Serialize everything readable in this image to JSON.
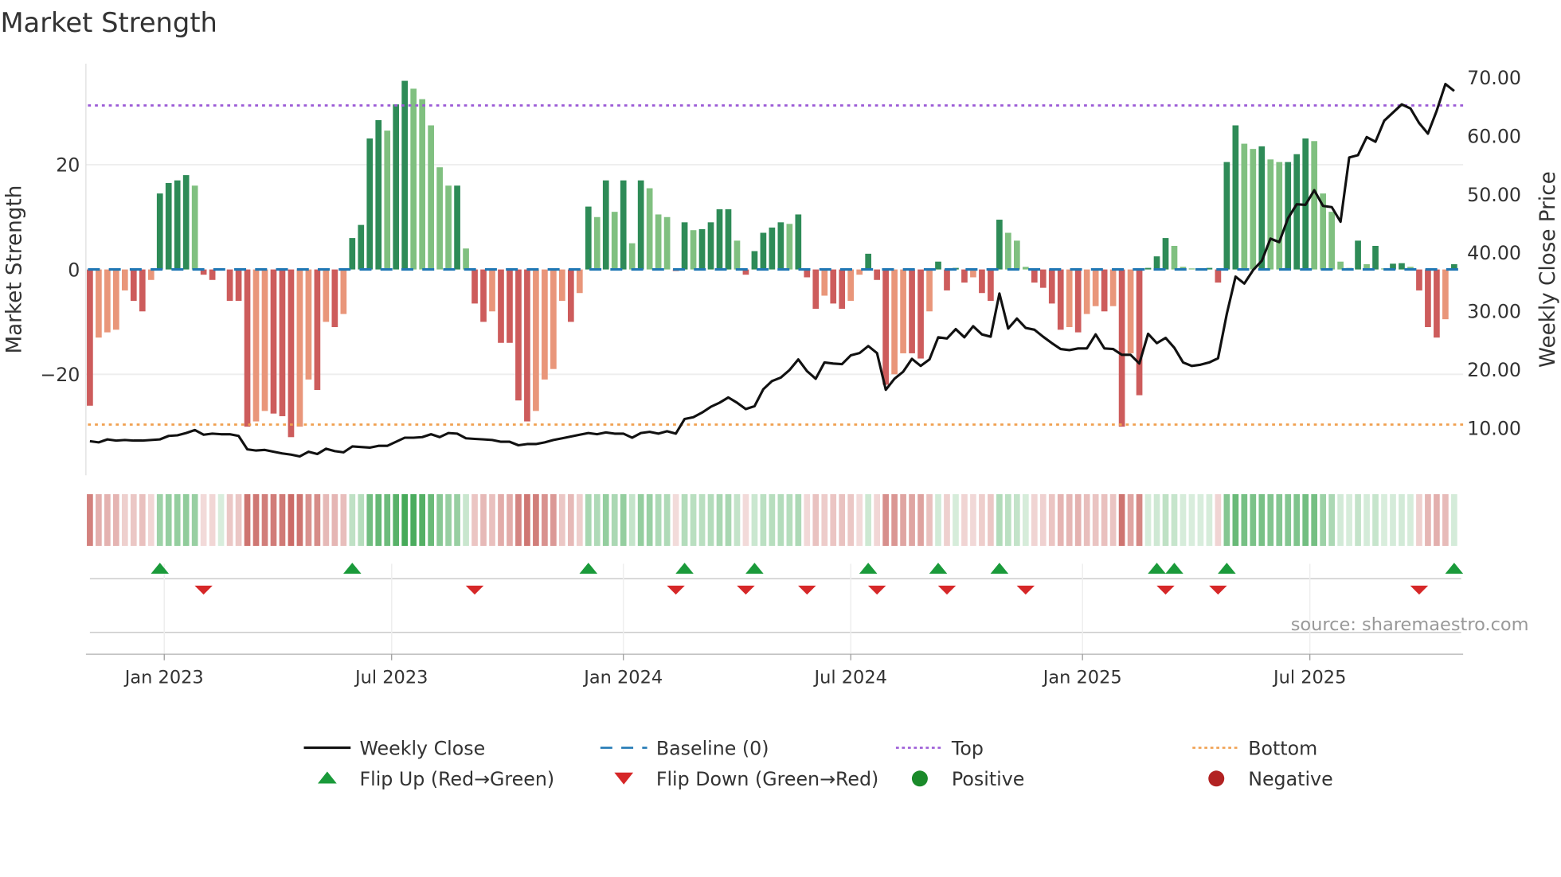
{
  "chart_data": {
    "type": "bar",
    "title": "Market Strength",
    "ylabel": "Market Strength",
    "ylabel_right": "Weekly Close Price",
    "ylim": [
      -39,
      39
    ],
    "ylim_right": [
      3.5,
      72
    ],
    "yticks": [
      {
        "v": 20,
        "label": "20"
      },
      {
        "v": 0,
        "label": "0"
      },
      {
        "v": -20,
        "label": "−20"
      }
    ],
    "yticks_right": [
      "70.00",
      "60.00",
      "50.00",
      "40.00",
      "30.00",
      "20.00",
      "10.00"
    ],
    "yticks_right_values": [
      70,
      60,
      50,
      40,
      30,
      20,
      10
    ],
    "xticks": [
      {
        "week": 8.5,
        "label": "Jan 2023"
      },
      {
        "week": 34.5,
        "label": "Jul 2023"
      },
      {
        "week": 61,
        "label": "Jan 2024"
      },
      {
        "week": 87,
        "label": "Jul 2024"
      },
      {
        "week": 113.5,
        "label": "Jan 2025"
      },
      {
        "week": 139.5,
        "label": "Jul 2025"
      }
    ],
    "top_level": 31.3,
    "bottom_level": -29.6,
    "baseline": 0,
    "strength": [
      -26,
      -13,
      -12,
      -11.5,
      -4,
      -6,
      -8,
      -2,
      14.5,
      16.5,
      17,
      18,
      16,
      -1,
      -2,
      0,
      -6,
      -6,
      -30,
      -29,
      -27,
      -27.5,
      -28,
      -32,
      -30,
      -21,
      -23,
      -10,
      -11,
      -8.5,
      6,
      8.5,
      25,
      28.5,
      26.5,
      31.5,
      36,
      34.5,
      32.5,
      27.5,
      19.5,
      16,
      16,
      4,
      -6.5,
      -10,
      -8,
      -14,
      -14,
      -25,
      -29,
      -27,
      -21,
      -19,
      -6,
      -10,
      -4.5,
      12,
      10,
      17,
      11,
      17,
      5,
      17,
      15.5,
      10.5,
      10,
      -0.3,
      9,
      7.5,
      7.7,
      9,
      11.5,
      11.5,
      5.5,
      -1,
      3.5,
      7,
      8,
      9,
      8.7,
      10.5,
      -1.5,
      -7.5,
      -5,
      -6.5,
      -7.5,
      -6,
      -1,
      3,
      -2,
      -22,
      -20,
      -16,
      -16,
      -17,
      -8,
      1.5,
      -4,
      0.3,
      -2.5,
      -1.5,
      -4.5,
      -6,
      9.5,
      7,
      5.5,
      0.5,
      -2.5,
      -3.5,
      -6.5,
      -11.5,
      -11,
      -12,
      -8.5,
      -7,
      -8,
      -7,
      -30,
      -16,
      -24,
      0.3,
      2.5,
      6,
      4.5,
      0.5,
      0.2,
      0.2,
      0.3,
      -2.5,
      20.5,
      27.5,
      24,
      23,
      23.5,
      21,
      20.5,
      20.5,
      22,
      25,
      24.5,
      14.5,
      11,
      1.5,
      0.3,
      5.5,
      1,
      4.5,
      0.2,
      1.1,
      1.2,
      0.5,
      -4,
      -11,
      -13,
      -9.5,
      1
    ],
    "close": [
      7.7,
      7.5,
      8.0,
      7.8,
      7.9,
      7.8,
      7.8,
      7.9,
      8.0,
      8.6,
      8.7,
      9.1,
      9.6,
      8.8,
      9.0,
      8.9,
      8.9,
      8.6,
      6.3,
      6.1,
      6.2,
      5.9,
      5.6,
      5.4,
      5.1,
      5.9,
      5.5,
      6.4,
      6.0,
      5.8,
      6.8,
      6.7,
      6.6,
      6.9,
      6.9,
      7.6,
      8.3,
      8.3,
      8.4,
      8.9,
      8.4,
      9.1,
      9.0,
      8.2,
      8.1,
      8.0,
      7.9,
      7.6,
      7.6,
      7.0,
      7.2,
      7.2,
      7.5,
      7.9,
      8.2,
      8.5,
      8.8,
      9.1,
      8.9,
      9.2,
      9.0,
      9.0,
      8.3,
      9.1,
      9.3,
      9.0,
      9.4,
      9.0,
      11.5,
      11.8,
      12.6,
      13.6,
      14.3,
      15.2,
      14.3,
      13.2,
      13.7,
      16.6,
      18.0,
      18.6,
      19.9,
      21.7,
      19.7,
      18.4,
      21.2,
      21.0,
      20.9,
      22.4,
      22.8,
      24.0,
      22.8,
      16.5,
      18.4,
      19.6,
      21.8,
      20.6,
      21.7,
      25.5,
      25.3,
      26.9,
      25.5,
      27.4,
      26.0,
      25.6,
      33.0,
      27.0,
      28.7,
      27.1,
      26.8,
      25.6,
      24.5,
      23.5,
      23.3,
      23.6,
      23.6,
      26.0,
      23.6,
      23.5,
      22.5,
      22.5,
      21.0,
      26.1,
      24.5,
      25.4,
      23.7,
      21.2,
      20.6,
      20.8,
      21.2,
      21.9,
      29.5,
      35.9,
      34.7,
      37.0,
      38.6,
      42.4,
      41.8,
      45.9,
      48.3,
      48.2,
      50.7,
      48.0,
      47.8,
      45.3,
      56.3,
      56.7,
      59.8,
      59.0,
      62.6,
      64.0,
      65.4,
      64.7,
      62.2,
      60.4,
      64.3,
      68.9,
      67.7
    ],
    "flip_up_weeks": [
      8,
      30,
      57,
      68,
      76,
      89,
      97,
      104,
      122,
      124,
      130,
      156
    ],
    "flip_down_weeks": [
      13,
      44,
      67,
      75,
      82,
      90,
      98,
      107,
      123,
      129,
      152
    ],
    "legend": [
      {
        "key": "close",
        "label": "Weekly Close"
      },
      {
        "key": "baseline",
        "label": "Baseline (0)"
      },
      {
        "key": "top",
        "label": "Top"
      },
      {
        "key": "bottom",
        "label": "Bottom"
      },
      {
        "key": "flip_up",
        "label": "Flip Up (Red→Green)"
      },
      {
        "key": "flip_down",
        "label": "Flip Down (Green→Red)"
      },
      {
        "key": "positive",
        "label": "Positive"
      },
      {
        "key": "negative",
        "label": "Negative"
      }
    ],
    "legend_placement": "bottom",
    "source": "source: sharemaestro.com",
    "colors": {
      "pos_up": "#2e8b57",
      "pos_down": "#80c080",
      "neg_down": "#cd5c5c",
      "neg_up": "#e9967a",
      "close": "#111111",
      "baseline": "#1f77b4",
      "top": "#9b59d6",
      "bottom": "#f0a050",
      "flip_up": "#1a9a3a",
      "flip_down": "#d62728",
      "positive": "#1a8a2a",
      "negative": "#b22222"
    }
  }
}
